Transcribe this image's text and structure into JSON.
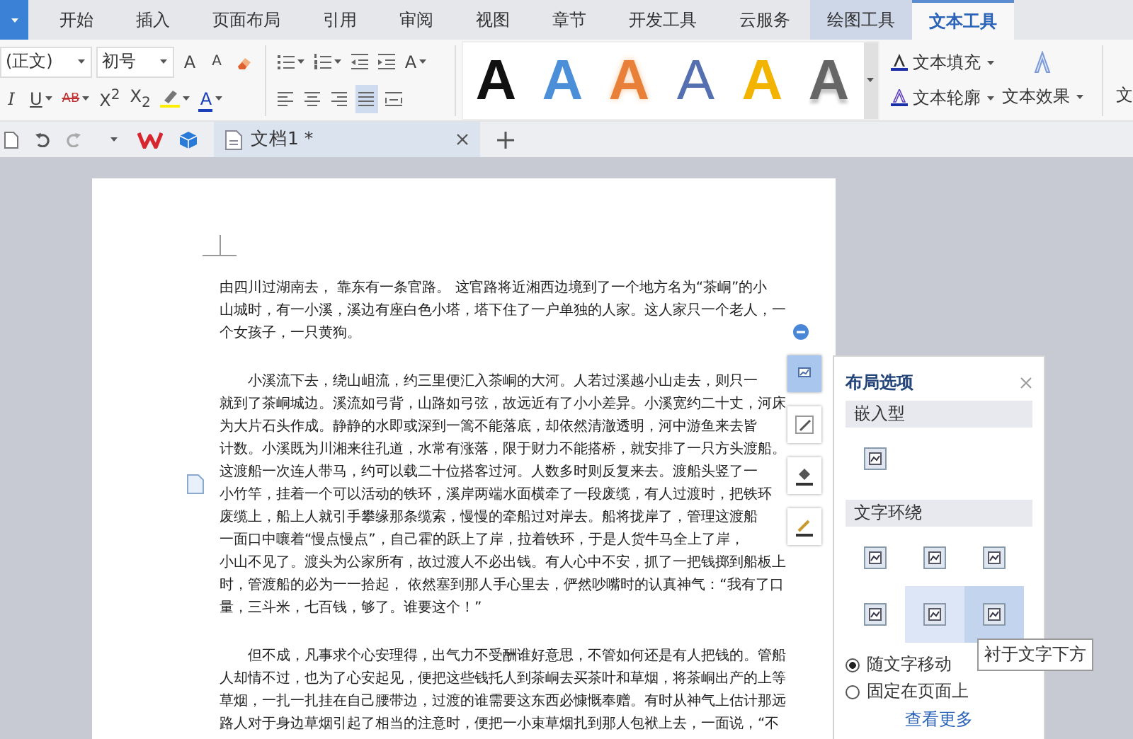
{
  "menu_tabs": [
    {
      "label": "开始",
      "kind": "normal",
      "selected": false
    },
    {
      "label": "插入",
      "kind": "normal",
      "selected": false
    },
    {
      "label": "页面布局",
      "kind": "normal",
      "selected": false
    },
    {
      "label": "引用",
      "kind": "normal",
      "selected": false
    },
    {
      "label": "审阅",
      "kind": "normal",
      "selected": false
    },
    {
      "label": "视图",
      "kind": "normal",
      "selected": false
    },
    {
      "label": "章节",
      "kind": "normal",
      "selected": false
    },
    {
      "label": "开发工具",
      "kind": "normal",
      "selected": false
    },
    {
      "label": "云服务",
      "kind": "normal",
      "selected": false
    },
    {
      "label": "绘图工具",
      "kind": "context",
      "selected": false
    },
    {
      "label": "文本工具",
      "kind": "context",
      "selected": true
    }
  ],
  "ribbon": {
    "font_name": "(正文)",
    "font_size": "初号",
    "font_row": [
      {
        "kind": "grow",
        "label": "A"
      },
      {
        "kind": "shrink",
        "label": "A"
      },
      {
        "kind": "clear"
      }
    ],
    "para_row": [
      {
        "kind": "bullets"
      },
      {
        "kind": "numbering"
      },
      {
        "kind": "outdent"
      },
      {
        "kind": "indent"
      },
      {
        "kind": "spacing",
        "label": "A"
      }
    ],
    "format_row": [
      {
        "kind": "italic",
        "label": "I"
      },
      {
        "kind": "underline",
        "label": "U"
      },
      {
        "kind": "strike",
        "label": "AB"
      },
      {
        "kind": "script",
        "label": "X$^{2}$"
      },
      {
        "kind": "script",
        "label": "X$_{2}$"
      },
      {
        "kind": "highlight"
      },
      {
        "kind": "color",
        "label": "A"
      }
    ],
    "alignment": [
      {
        "kind": "left",
        "selected": false
      },
      {
        "kind": "center",
        "selected": false
      },
      {
        "kind": "right",
        "selected": false
      },
      {
        "kind": "justify",
        "selected": true
      },
      {
        "kind": "distribute",
        "selected": false
      }
    ],
    "styles": [
      {
        "label": "A",
        "kind": "solid",
        "color": "#111111"
      },
      {
        "label": "A",
        "kind": "solid",
        "color": "#4a8fd8"
      },
      {
        "label": "A",
        "kind": "glow",
        "color": "#e8803a"
      },
      {
        "label": "A",
        "kind": "outline",
        "color": "#5470b0"
      },
      {
        "label": "A",
        "kind": "solid",
        "color": "#f2b400"
      },
      {
        "label": "A",
        "kind": "gradient",
        "color": "#666666"
      }
    ],
    "text_fill": "文本填充",
    "text_outline": "文本轮廓",
    "text_effect": "文本效果",
    "cut_label": "文"
  },
  "document_tab": {
    "title": "文档1 *",
    "selected": true
  },
  "floating_tools": [
    {
      "kind": "layout",
      "selected": true
    },
    {
      "kind": "pen",
      "selected": false
    },
    {
      "kind": "fill",
      "selected": false
    },
    {
      "kind": "outline",
      "selected": false
    }
  ],
  "document": {
    "paragraphs": [
      {
        "lines": [
          "由四川过湖南去， 靠东有一条官路。 这官路将近湘西边境到了一个地方名为“茶峒”的小",
          "山城时，有一小溪，溪边有座白色小塔，塔下住了一户单独的人家。这人家只一个老人，一",
          "个女孩子，一只黄狗。"
        ]
      },
      {
        "lines": [
          "　　小溪流下去，绕山岨流，约三里便汇入茶峒的大河。人若过溪越小山走去，则只一",
          "就到了茶峒城边。溪流如弓背，山路如弓弦，故远近有了小小差异。小溪宽约二十丈，河床",
          "为大片石头作成。静静的水即或深到一篙不能落底，却依然清澈透明，河中游鱼来去皆",
          "计数。小溪既为川湘来往孔道，水常有涨落，限于财力不能搭桥，就安排了一只方头渡船。",
          "这渡船一次连人带马，约可以载二十位搭客过河。人数多时则反复来去。渡船头竖了一",
          "小竹竿，挂着一个可以活动的铁环，溪岸两端水面横牵了一段废缆，有人过渡时，把铁环",
          "废缆上，船上人就引手攀缘那条缆索，慢慢的牵船过对岸去。船将拢岸了，管理这渡船",
          "一面口中嚷着“慢点慢点”，自己霍的跃上了岸，拉着铁环，于是人货牛马全上了岸，",
          "小山不见了。渡头为公家所有，故过渡人不必出钱。有人心中不安，抓了一把钱掷到船板上",
          "时，管渡船的必为一一拾起， 依然塞到那人手心里去，俨然吵嘴时的认真神气：“我有了口",
          "量，三斗米，七百钱，够了。谁要这个！”"
        ]
      },
      {
        "lines": [
          "　　但不成，凡事求个心安理得，出气力不受酬谁好意思，不管如何还是有人把钱的。管船",
          "人却情不过，也为了心安起见，便把这些钱托人到茶峒去买茶叶和草烟，将茶峒出产的上等",
          "草烟，一扎一扎挂在自己腰带边，过渡的谁需要这东西必慷慨奉赠。有时从神气上估计那远",
          "路人对于身边草烟引起了相当的注意时，便把一小束草烟扎到那人包袱上去，一面说，“不"
        ]
      }
    ]
  },
  "layout_panel": {
    "title": "布局选项",
    "inline_header": "嵌入型",
    "inline_options": [
      {
        "selected": false
      }
    ],
    "wrap_header": "文字环绕",
    "wrap_options": [
      {
        "selected": false,
        "hovered": false
      },
      {
        "selected": false,
        "hovered": false
      },
      {
        "selected": false,
        "hovered": false
      },
      {
        "selected": false,
        "hovered": false
      },
      {
        "selected": false,
        "hovered": true
      },
      {
        "selected": true,
        "hovered": false
      }
    ],
    "tooltip": "衬于文字下方",
    "position_options": [
      {
        "label": "随文字移动",
        "selected": true
      },
      {
        "label": "固定在页面上",
        "selected": false
      }
    ],
    "more_link": "查看更多"
  }
}
